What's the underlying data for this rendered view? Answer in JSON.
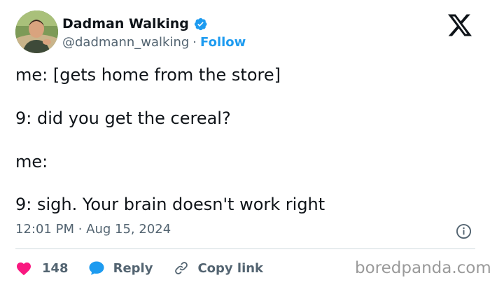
{
  "author": {
    "display_name": "Dadman Walking",
    "handle": "@dadmann_walking",
    "separator": "·",
    "follow_label": "Follow",
    "verified": true
  },
  "tweet": {
    "lines": [
      "me: [gets home from the store]",
      "9: did you get the cereal?",
      "me:",
      "9: sigh. Your brain doesn't work right"
    ],
    "timestamp": "12:01 PM · Aug 15, 2024"
  },
  "actions": {
    "like_count": "148",
    "reply_label": "Reply",
    "copy_link_label": "Copy link"
  },
  "watermark": "boredpanda.com",
  "colors": {
    "accent": "#1d9bf0",
    "like": "#f91880",
    "muted": "#536471",
    "text": "#0f1419",
    "divider": "#cfd9de"
  },
  "icons": [
    "avatar",
    "verified-badge-icon",
    "x-logo-icon",
    "info-icon",
    "heart-icon",
    "reply-bubble-icon",
    "link-icon"
  ]
}
